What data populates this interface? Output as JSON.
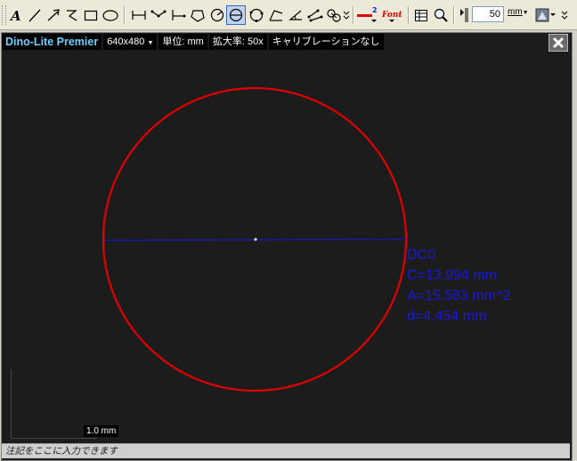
{
  "toolbar": {
    "tools": [
      "text-tool-icon",
      "line-tool-icon",
      "arrow-tool-icon",
      "freehand-tool-icon",
      "rectangle-tool-icon",
      "ellipse-tool-icon",
      "distance-tool-icon",
      "polyline-distance-tool-icon",
      "perpendicular-tool-icon",
      "polygon-tool-icon",
      "circle-radius-tool-icon",
      "circle-diameter-tool-icon",
      "circle-three-point-tool-icon",
      "angle-polyline-tool-icon",
      "angle-tool-icon",
      "angle-four-point-tool-icon",
      "center-distance-tool-icon"
    ],
    "line_width_badge": "2",
    "font_label": "Font",
    "zoom_value": "50",
    "unit": "mm",
    "colors": {
      "line_color": "#e00000",
      "active_bg": "#c1d2ee"
    }
  },
  "viewer": {
    "brand": "Dino-Lite Premier",
    "resolution": "640x480",
    "unit_label": "単位: mm",
    "magnification_label": "拡大率: 50x",
    "calibration_status": "キャリブレーションなし",
    "colors": {
      "circle": "#e00000",
      "diameter_line": "#1a1a9a",
      "measure_text": "#1818e0",
      "brand": "#6fd0ff"
    }
  },
  "measurement": {
    "name": "DC0",
    "circumference": "C=13.994 mm",
    "area": "A=15.583 mm^2",
    "diameter": "d=4.454 mm"
  },
  "scale_bar": {
    "label": "1.0 mm"
  },
  "annotation": {
    "placeholder": "注記をここに入力できます"
  }
}
